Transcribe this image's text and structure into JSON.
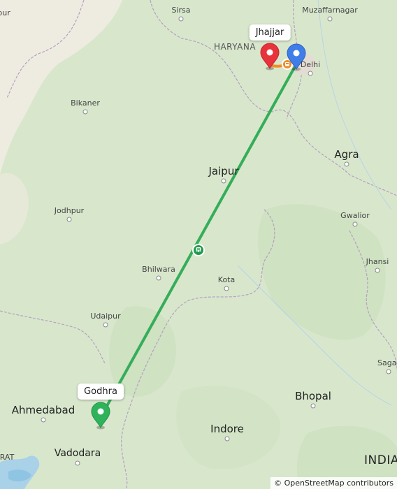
{
  "map": {
    "places": [
      {
        "id": "sirsa",
        "label": "Sirsa",
        "size": "small"
      },
      {
        "id": "muzaffarnagar",
        "label": "Muzaffarnagar",
        "size": "small"
      },
      {
        "id": "haryana",
        "label": "HARYANA",
        "size": "region"
      },
      {
        "id": "delhi",
        "label": "Delhi",
        "size": "small"
      },
      {
        "id": "bikaner",
        "label": "Bikaner",
        "size": "small"
      },
      {
        "id": "agra",
        "label": "Agra",
        "size": "large"
      },
      {
        "id": "jaipur",
        "label": "Jaipur",
        "size": "large"
      },
      {
        "id": "jodhpur",
        "label": "Jodhpur",
        "size": "small"
      },
      {
        "id": "gwalior",
        "label": "Gwalior",
        "size": "small"
      },
      {
        "id": "jhansi",
        "label": "Jhansi",
        "size": "small"
      },
      {
        "id": "bhilwara",
        "label": "Bhilwara",
        "size": "small"
      },
      {
        "id": "kota",
        "label": "Kota",
        "size": "small"
      },
      {
        "id": "udaipur",
        "label": "Udaipur",
        "size": "small"
      },
      {
        "id": "sagar",
        "label": "Sagar",
        "size": "small"
      },
      {
        "id": "ahmedabad",
        "label": "Ahmedabad",
        "size": "large"
      },
      {
        "id": "bhopal",
        "label": "Bhopal",
        "size": "large"
      },
      {
        "id": "indore",
        "label": "Indore",
        "size": "large"
      },
      {
        "id": "vadodara",
        "label": "Vadodara",
        "size": "medium"
      },
      {
        "id": "india",
        "label": "INDIA",
        "size": "country"
      },
      {
        "id": "edge_rat",
        "label": "RAT",
        "size": "small"
      },
      {
        "id": "edge_ipur",
        "label": "ipur",
        "size": "small"
      }
    ],
    "markers": [
      {
        "id": "godhra",
        "label": "Godhra",
        "color": "#2fb35a",
        "role": "origin"
      },
      {
        "id": "jhajjar",
        "label": "Jhajjar",
        "color": "#e8333c",
        "role": "destination"
      },
      {
        "id": "delhi-stop",
        "label": "",
        "color": "#3f7de8",
        "role": "stop"
      }
    ],
    "routes": [
      {
        "id": "train-route",
        "mode": "train",
        "color": "#35ad5a"
      },
      {
        "id": "road-route",
        "mode": "road",
        "color": "#f28c28"
      }
    ],
    "attribution": "© OpenStreetMap contributors"
  }
}
